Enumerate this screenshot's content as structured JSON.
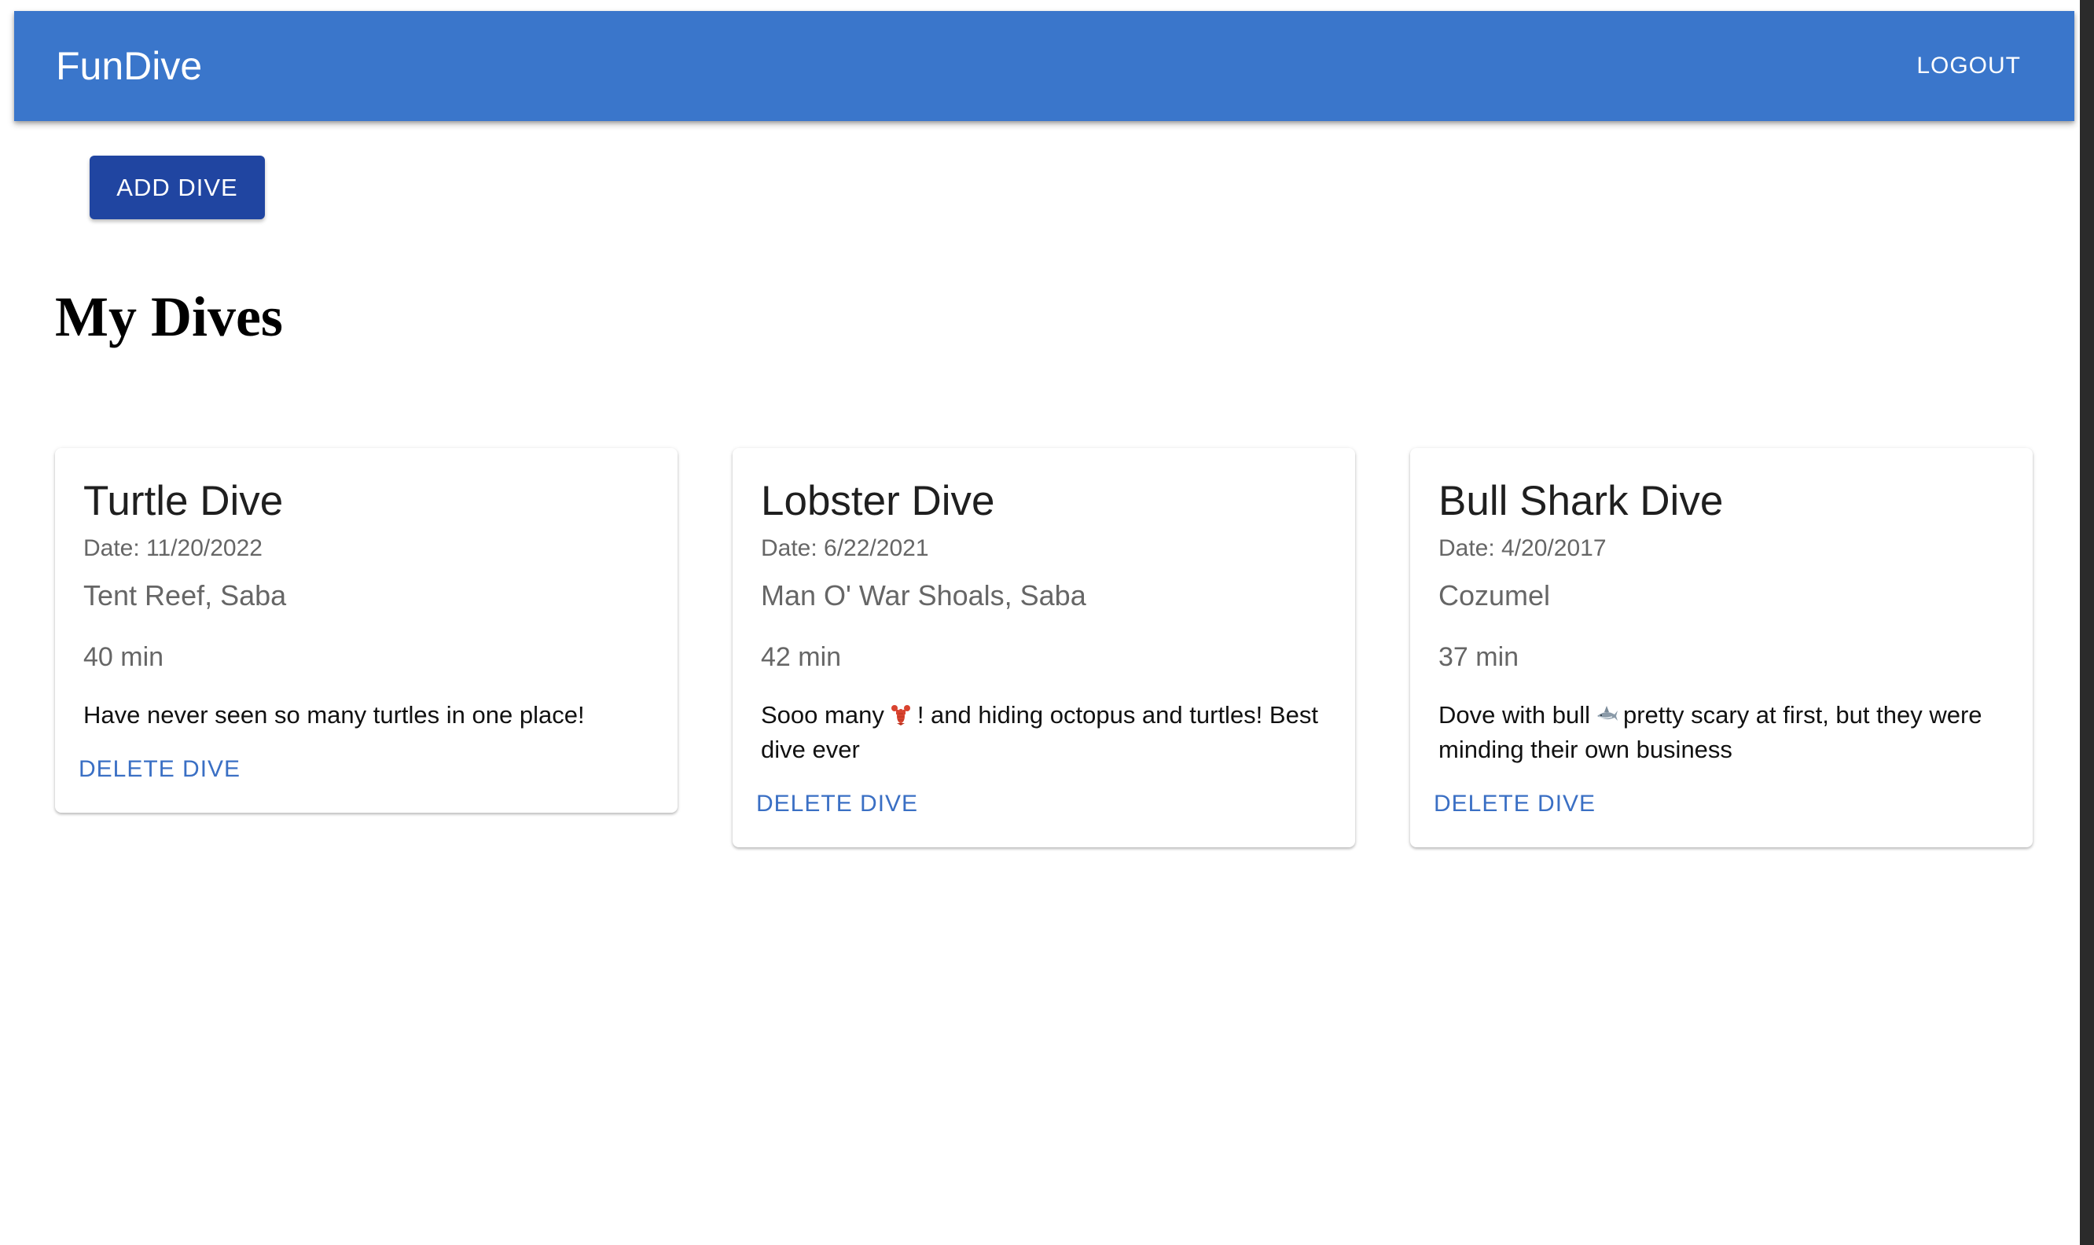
{
  "appbar": {
    "title": "FunDive",
    "logout_label": "LOGOUT",
    "color": "#3a76cb"
  },
  "toolbar": {
    "add_label": "ADD DIVE",
    "add_color": "#2045a1"
  },
  "main": {
    "heading": "My Dives"
  },
  "dives": [
    {
      "title": "Turtle Dive",
      "date": "Date: 11/20/2022",
      "location": "Tent Reef, Saba",
      "duration": "40 min",
      "notes_before": "Have never seen so many turtles in one place!",
      "emoji": "",
      "notes_after": "",
      "delete_label": "DELETE DIVE"
    },
    {
      "title": "Lobster Dive",
      "date": "Date: 6/22/2021",
      "location": "Man O' War Shoals, Saba",
      "duration": "42 min",
      "notes_before": "Sooo many",
      "emoji": "lobster-emoji",
      "notes_after": "! and hiding octopus and turtles! Best dive ever",
      "delete_label": "DELETE DIVE"
    },
    {
      "title": "Bull Shark Dive",
      "date": "Date: 4/20/2017",
      "location": "Cozumel",
      "duration": "37 min",
      "notes_before": "Dove with bull",
      "emoji": "shark-emoji",
      "notes_after": "pretty scary at first, but they were minding their own business",
      "delete_label": "DELETE DIVE"
    }
  ],
  "colors": {
    "link": "#3a6fc4"
  }
}
